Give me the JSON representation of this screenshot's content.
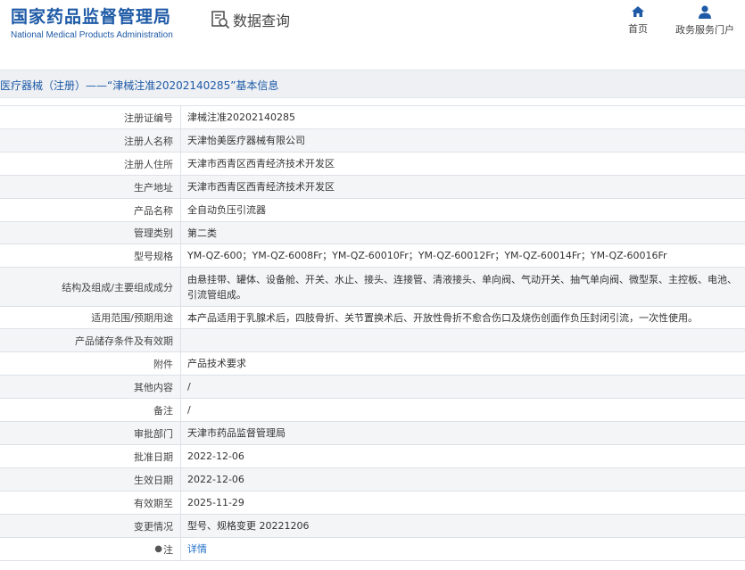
{
  "header": {
    "logo_cn": "国家药品监督管理局",
    "logo_en": "National Medical Products Administration",
    "query_label": "数据查询",
    "nav": {
      "home": "首页",
      "portal": "政务服务门户"
    }
  },
  "title": "医疗器械（注册）——“津械注准20202140285”基本信息",
  "rows": [
    {
      "label": "注册证编号",
      "value": "津械注准20202140285"
    },
    {
      "label": "注册人名称",
      "value": "天津怡美医疗器械有限公司"
    },
    {
      "label": "注册人住所",
      "value": "天津市西青区西青经济技术开发区"
    },
    {
      "label": "生产地址",
      "value": "天津市西青区西青经济技术开发区"
    },
    {
      "label": "产品名称",
      "value": "全自动负压引流器"
    },
    {
      "label": "管理类别",
      "value": "第二类"
    },
    {
      "label": "型号规格",
      "value": "YM-QZ-600；YM-QZ-6008Fr；YM-QZ-60010Fr；YM-QZ-60012Fr；YM-QZ-60014Fr；YM-QZ-60016Fr"
    },
    {
      "label": "结构及组成/主要组成成分",
      "value": "由悬挂带、罐体、设备舱、开关、水止、接头、连接管、清液接头、单向阀、气动开关、抽气单向阀、微型泵、主控板、电池、引流管组成。"
    },
    {
      "label": "适用范围/预期用途",
      "value": "本产品适用于乳腺术后，四肢骨折、关节置换术后、开放性骨折不愈合伤口及烧伤创面作负压封闭引流，一次性使用。"
    },
    {
      "label": "产品储存条件及有效期",
      "value": ""
    },
    {
      "label": "附件",
      "value": "产品技术要求"
    },
    {
      "label": "其他内容",
      "value": "/"
    },
    {
      "label": "备注",
      "value": "/"
    },
    {
      "label": "审批部门",
      "value": "天津市药品监督管理局"
    },
    {
      "label": "批准日期",
      "value": "2022-12-06"
    },
    {
      "label": "生效日期",
      "value": "2022-12-06"
    },
    {
      "label": "有效期至",
      "value": "2025-11-29"
    },
    {
      "label": "变更情况",
      "value": "型号、规格变更 20221206"
    },
    {
      "label": "注",
      "value": "详情"
    }
  ],
  "colors": {
    "brand": "#1e5aa6",
    "link": "#1e6fc9",
    "title_bg": "#eef0f4"
  }
}
